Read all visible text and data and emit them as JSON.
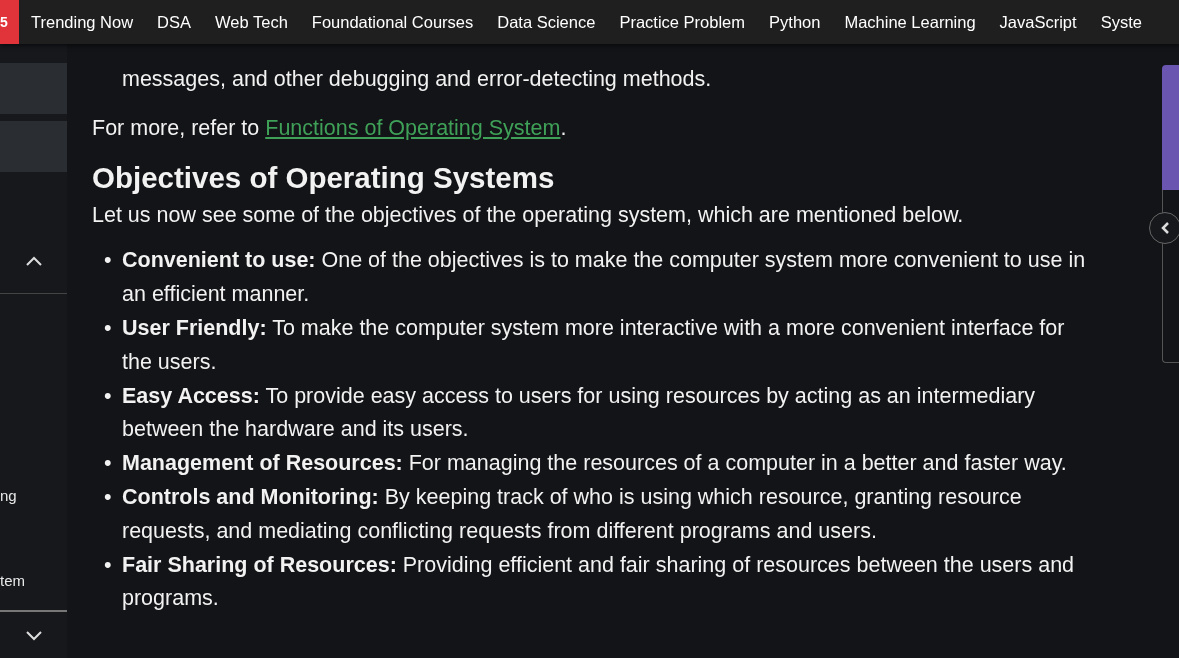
{
  "nav": {
    "badge": "5",
    "items": [
      "Trending Now",
      "DSA",
      "Web Tech",
      "Foundational Courses",
      "Data Science",
      "Practice Problem",
      "Python",
      "Machine Learning",
      "JavaScript",
      "Syste"
    ]
  },
  "sidebar": {
    "items": [
      "ng",
      "tem"
    ]
  },
  "article": {
    "continued_text": "messages, and other debugging and error-detecting methods.",
    "refer": {
      "text": "For more, refer to ",
      "link": "Functions of Operating System",
      "after": "."
    },
    "heading": "Objectives of Operating Systems",
    "intro": "Let us now see some of the objectives of the operating system, which are mentioned below.",
    "bullets": [
      {
        "marker": "•",
        "term": "Convenient to use:",
        "text": "One of the objectives is to make the computer system more convenient to use in an efficient manner."
      },
      {
        "marker": "•",
        "term": "User Friendly:",
        "text": "To make the computer system more interactive with a more convenient interface for the users."
      },
      {
        "marker": "•",
        "term": "Easy Access:",
        "text": "To provide easy access to users for using resources by acting as an intermediary between the hardware and its users."
      },
      {
        "marker": "•",
        "term": "Management of Resources:",
        "text": "For managing the resources of a computer in a better and faster way."
      },
      {
        "marker": "•",
        "term": "Controls and Monitoring:",
        "text": "By keeping track of who is using which resource, granting resource requests, and mediating conflicting requests from different programs and users."
      },
      {
        "marker": "•",
        "term": "Fair Sharing of Resources:",
        "text": "Providing efficient and fair sharing of resources between the users and programs."
      }
    ]
  }
}
